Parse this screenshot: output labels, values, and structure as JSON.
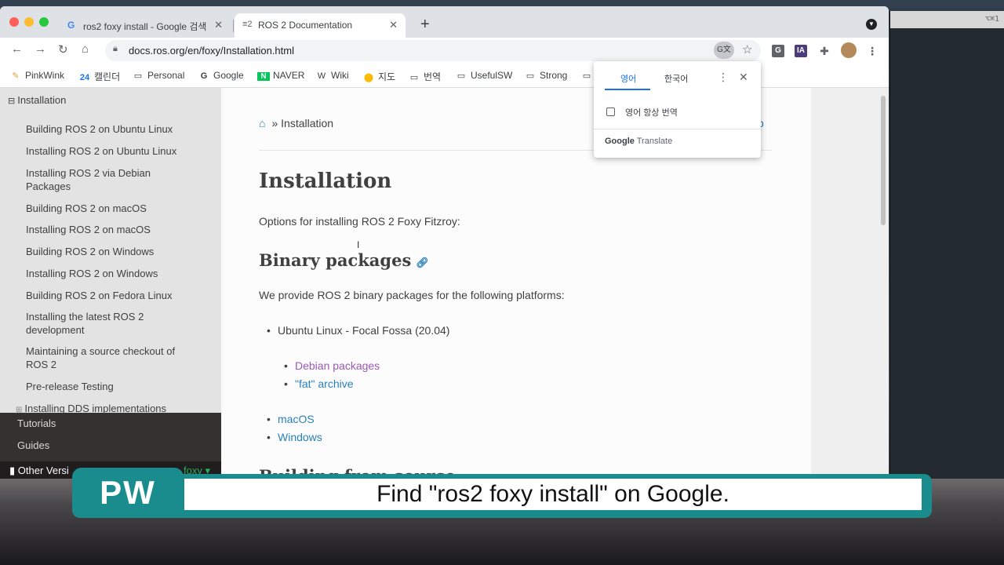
{
  "tabs": [
    {
      "title": "ros2 foxy install - Google 검색",
      "icon": "G"
    },
    {
      "title": "ROS 2 Documentation",
      "icon": "≡2"
    }
  ],
  "address": {
    "url": "docs.ros.org/en/foxy/Installation.html"
  },
  "bookmarks": [
    {
      "label": "PinkWink",
      "icon": "pinkwink-icon"
    },
    {
      "label": "캘린더",
      "icon": "calendar-icon"
    },
    {
      "label": "Personal",
      "icon": "folder-icon"
    },
    {
      "label": "Google",
      "icon": "google-icon"
    },
    {
      "label": "NAVER",
      "icon": "naver-icon"
    },
    {
      "label": "Wiki",
      "icon": "wikipedia-icon"
    },
    {
      "label": "지도",
      "icon": "maps-icon"
    },
    {
      "label": "번역",
      "icon": "folder-icon"
    },
    {
      "label": "UsefulSW",
      "icon": "folder-icon"
    },
    {
      "label": "Strong",
      "icon": "folder-icon"
    }
  ],
  "sidebar": {
    "heading": "Installation",
    "items": [
      "Building ROS 2 on Ubuntu Linux",
      "Installing ROS 2 on Ubuntu Linux",
      "Installing ROS 2 via Debian Packages",
      "Building ROS 2 on macOS",
      "Installing ROS 2 on macOS",
      "Building ROS 2 on Windows",
      "Installing ROS 2 on Windows",
      "Building ROS 2 on Fedora Linux",
      "Installing the latest ROS 2 development",
      "Maintaining a source checkout of ROS 2",
      "Pre-release Testing",
      "Installing DDS implementations"
    ],
    "sections": [
      "Tutorials",
      "Guides"
    ],
    "versions_label": "Other Versi",
    "version": "foxy"
  },
  "main": {
    "breadcrumb": "» Installation",
    "breadcrumb_right": "b",
    "title": "Installation",
    "intro": "Options for installing ROS 2 Foxy Fitzroy:",
    "h2_binary": "Binary packages",
    "binary_text": "We provide ROS 2 binary packages for the following platforms:",
    "platforms": {
      "ubuntu": "Ubuntu Linux - Focal Fossa (20.04)",
      "debian": "Debian packages",
      "fat": "\"fat\" archive",
      "macos": "macOS",
      "windows": "Windows"
    },
    "h2_source": "Building from source"
  },
  "translate_popup": {
    "tab_source": "영어",
    "tab_target": "한국어",
    "always_translate": "영어 항상 번역",
    "footer_brand": "Google",
    "footer_text": "Translate"
  },
  "terminal": {
    "shortcut": "⌥⌘1"
  },
  "caption": {
    "logo": "PW",
    "text": "Find \"ros2 foxy install\" on Google."
  }
}
